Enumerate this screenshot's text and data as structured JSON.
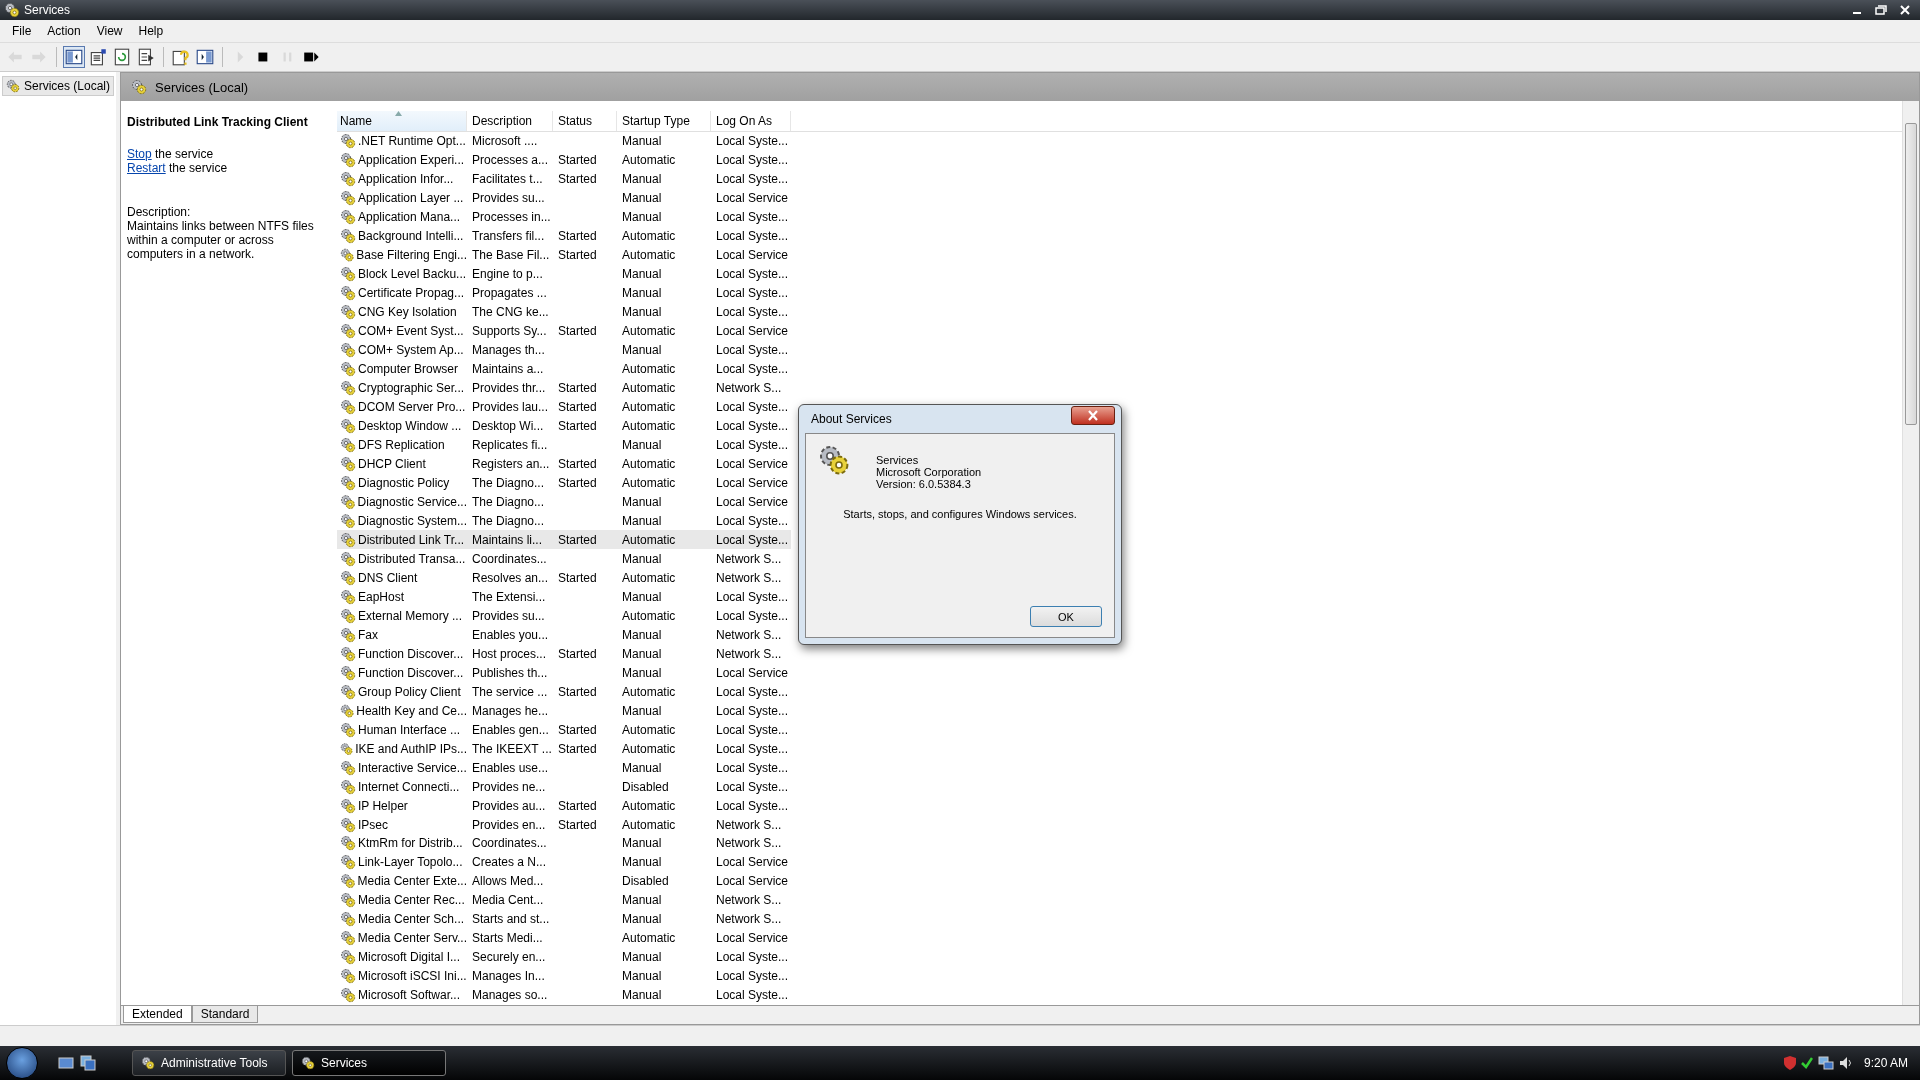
{
  "window": {
    "title": "Services"
  },
  "menu": [
    "File",
    "Action",
    "View",
    "Help"
  ],
  "toolbar": [
    {
      "kind": "back",
      "disabled": true,
      "pressed": false
    },
    {
      "kind": "forward",
      "disabled": true,
      "pressed": false
    },
    {
      "kind": "separator"
    },
    {
      "kind": "tree-toggle",
      "disabled": false,
      "pressed": true
    },
    {
      "kind": "properties",
      "disabled": false,
      "pressed": false
    },
    {
      "kind": "refresh",
      "disabled": false,
      "pressed": false
    },
    {
      "kind": "export",
      "disabled": false,
      "pressed": false
    },
    {
      "kind": "separator"
    },
    {
      "kind": "help",
      "disabled": false,
      "pressed": false
    },
    {
      "kind": "action-pane",
      "disabled": false,
      "pressed": false
    },
    {
      "kind": "separator"
    },
    {
      "kind": "start",
      "disabled": true,
      "pressed": false
    },
    {
      "kind": "stop",
      "disabled": false,
      "pressed": false
    },
    {
      "kind": "pause",
      "disabled": true,
      "pressed": false
    },
    {
      "kind": "restart",
      "disabled": false,
      "pressed": false
    }
  ],
  "tree": {
    "items": [
      {
        "label": "Services (Local)",
        "selected": true
      }
    ]
  },
  "pane": {
    "title": "Services (Local)"
  },
  "details": {
    "title": "Distributed Link Tracking Client",
    "actions": [
      {
        "link": "Stop",
        "text": "the service"
      },
      {
        "link": "Restart",
        "text": "the service"
      }
    ],
    "description_label": "Description:",
    "description": "Maintains links between NTFS files within a computer or across computers in a network."
  },
  "table": {
    "columns": [
      {
        "label": "Name",
        "sorted": true
      },
      {
        "label": "Description",
        "sorted": false
      },
      {
        "label": "Status",
        "sorted": false
      },
      {
        "label": "Startup Type",
        "sorted": false
      },
      {
        "label": "Log On As",
        "sorted": false
      }
    ],
    "rows": [
      {
        "name": ".NET Runtime Opt...",
        "description": "Microsoft ....",
        "startup": "Manual",
        "logon": "Local Syste...",
        "selected": false
      },
      {
        "name": "Application Experi...",
        "description": "Processes a...",
        "status": "Started",
        "startup": "Automatic",
        "logon": "Local Syste...",
        "selected": false
      },
      {
        "name": "Application Infor...",
        "description": "Facilitates t...",
        "status": "Started",
        "startup": "Manual",
        "logon": "Local Syste...",
        "selected": false
      },
      {
        "name": "Application Layer ...",
        "description": "Provides su...",
        "startup": "Manual",
        "logon": "Local Service",
        "selected": false
      },
      {
        "name": "Application Mana...",
        "description": "Processes in...",
        "startup": "Manual",
        "logon": "Local Syste...",
        "selected": false
      },
      {
        "name": "Background Intelli...",
        "description": "Transfers fil...",
        "status": "Started",
        "startup": "Automatic",
        "logon": "Local Syste...",
        "selected": false
      },
      {
        "name": "Base Filtering Engi...",
        "description": "The Base Fil...",
        "status": "Started",
        "startup": "Automatic",
        "logon": "Local Service",
        "selected": false
      },
      {
        "name": "Block Level Backu...",
        "description": "Engine to p...",
        "startup": "Manual",
        "logon": "Local Syste...",
        "selected": false
      },
      {
        "name": "Certificate Propag...",
        "description": "Propagates ...",
        "startup": "Manual",
        "logon": "Local Syste...",
        "selected": false
      },
      {
        "name": "CNG Key Isolation",
        "description": "The CNG ke...",
        "startup": "Manual",
        "logon": "Local Syste...",
        "selected": false
      },
      {
        "name": "COM+ Event Syst...",
        "description": "Supports Sy...",
        "status": "Started",
        "startup": "Automatic",
        "logon": "Local Service",
        "selected": false
      },
      {
        "name": "COM+ System Ap...",
        "description": "Manages th...",
        "startup": "Manual",
        "logon": "Local Syste...",
        "selected": false
      },
      {
        "name": "Computer Browser",
        "description": "Maintains a...",
        "startup": "Automatic",
        "logon": "Local Syste...",
        "selected": false
      },
      {
        "name": "Cryptographic Ser...",
        "description": "Provides thr...",
        "status": "Started",
        "startup": "Automatic",
        "logon": "Network S...",
        "selected": false
      },
      {
        "name": "DCOM Server Pro...",
        "description": "Provides lau...",
        "status": "Started",
        "startup": "Automatic",
        "logon": "Local Syste...",
        "selected": false
      },
      {
        "name": "Desktop Window ...",
        "description": "Desktop Wi...",
        "status": "Started",
        "startup": "Automatic",
        "logon": "Local Syste...",
        "selected": false
      },
      {
        "name": "DFS Replication",
        "description": "Replicates fi...",
        "startup": "Manual",
        "logon": "Local Syste...",
        "selected": false
      },
      {
        "name": "DHCP Client",
        "description": "Registers an...",
        "status": "Started",
        "startup": "Automatic",
        "logon": "Local Service",
        "selected": false
      },
      {
        "name": "Diagnostic Policy",
        "description": "The Diagno...",
        "status": "Started",
        "startup": "Automatic",
        "logon": "Local Service",
        "selected": false
      },
      {
        "name": "Diagnostic Service...",
        "description": "The Diagno...",
        "startup": "Manual",
        "logon": "Local Service",
        "selected": false
      },
      {
        "name": "Diagnostic System...",
        "description": "The Diagno...",
        "startup": "Manual",
        "logon": "Local Syste...",
        "selected": false
      },
      {
        "name": "Distributed Link Tr...",
        "description": "Maintains li...",
        "status": "Started",
        "startup": "Automatic",
        "logon": "Local Syste...",
        "selected": true
      },
      {
        "name": "Distributed Transa...",
        "description": "Coordinates...",
        "startup": "Manual",
        "logon": "Network S...",
        "selected": false
      },
      {
        "name": "DNS Client",
        "description": "Resolves an...",
        "status": "Started",
        "startup": "Automatic",
        "logon": "Network S...",
        "selected": false
      },
      {
        "name": "EapHost",
        "description": "The Extensi...",
        "startup": "Manual",
        "logon": "Local Syste...",
        "selected": false
      },
      {
        "name": "External Memory ...",
        "description": "Provides su...",
        "startup": "Automatic",
        "logon": "Local Syste...",
        "selected": false
      },
      {
        "name": "Fax",
        "description": "Enables you...",
        "startup": "Manual",
        "logon": "Network S...",
        "selected": false
      },
      {
        "name": "Function Discover...",
        "description": "Host proces...",
        "status": "Started",
        "startup": "Manual",
        "logon": "Network S...",
        "selected": false
      },
      {
        "name": "Function Discover...",
        "description": "Publishes th...",
        "startup": "Manual",
        "logon": "Local Service",
        "selected": false
      },
      {
        "name": "Group Policy Client",
        "description": "The service ...",
        "status": "Started",
        "startup": "Automatic",
        "logon": "Local Syste...",
        "selected": false
      },
      {
        "name": "Health Key and Ce...",
        "description": "Manages he...",
        "startup": "Manual",
        "logon": "Local Syste...",
        "selected": false
      },
      {
        "name": "Human Interface ...",
        "description": "Enables gen...",
        "status": "Started",
        "startup": "Automatic",
        "logon": "Local Syste...",
        "selected": false
      },
      {
        "name": "IKE and AuthIP IPs...",
        "description": "The IKEEXT ...",
        "status": "Started",
        "startup": "Automatic",
        "logon": "Local Syste...",
        "selected": false
      },
      {
        "name": "Interactive Service...",
        "description": "Enables use...",
        "startup": "Manual",
        "logon": "Local Syste...",
        "selected": false
      },
      {
        "name": "Internet Connecti...",
        "description": "Provides ne...",
        "startup": "Disabled",
        "logon": "Local Syste...",
        "selected": false
      },
      {
        "name": "IP Helper",
        "description": "Provides au...",
        "status": "Started",
        "startup": "Automatic",
        "logon": "Local Syste...",
        "selected": false
      },
      {
        "name": "IPsec",
        "description": "Provides en...",
        "status": "Started",
        "startup": "Automatic",
        "logon": "Network S...",
        "selected": false
      },
      {
        "name": "KtmRm for Distrib...",
        "description": "Coordinates...",
        "startup": "Manual",
        "logon": "Network S...",
        "selected": false
      },
      {
        "name": "Link-Layer Topolo...",
        "description": "Creates a N...",
        "startup": "Manual",
        "logon": "Local Service",
        "selected": false
      },
      {
        "name": "Media Center Exte...",
        "description": "Allows Med...",
        "startup": "Disabled",
        "logon": "Local Service",
        "selected": false
      },
      {
        "name": "Media Center Rec...",
        "description": "Media Cent...",
        "startup": "Manual",
        "logon": "Network S...",
        "selected": false
      },
      {
        "name": "Media Center Sch...",
        "description": "Starts and st...",
        "startup": "Manual",
        "logon": "Network S...",
        "selected": false
      },
      {
        "name": "Media Center Serv...",
        "description": "Starts Medi...",
        "startup": "Automatic",
        "logon": "Local Service",
        "selected": false
      },
      {
        "name": "Microsoft Digital I...",
        "description": "Securely en...",
        "startup": "Manual",
        "logon": "Local Syste...",
        "selected": false
      },
      {
        "name": "Microsoft iSCSI Ini...",
        "description": "Manages In...",
        "startup": "Manual",
        "logon": "Local Syste...",
        "selected": false
      },
      {
        "name": "Microsoft Softwar...",
        "description": "Manages so...",
        "startup": "Manual",
        "logon": "Local Syste...",
        "selected": false
      }
    ]
  },
  "view_tabs": [
    {
      "label": "Extended",
      "selected": true
    },
    {
      "label": "Standard",
      "selected": false
    }
  ],
  "dialog": {
    "title": "About Services",
    "product": "Services",
    "company": "Microsoft Corporation",
    "version": "Version: 6.0.5384.3",
    "text": "Starts, stops, and configures Windows services.",
    "button": "OK"
  },
  "taskbar": {
    "tasks": [
      {
        "label": "Administrative Tools",
        "selected": false
      },
      {
        "label": "Services",
        "selected": true
      }
    ],
    "clock": "9:20 AM"
  }
}
